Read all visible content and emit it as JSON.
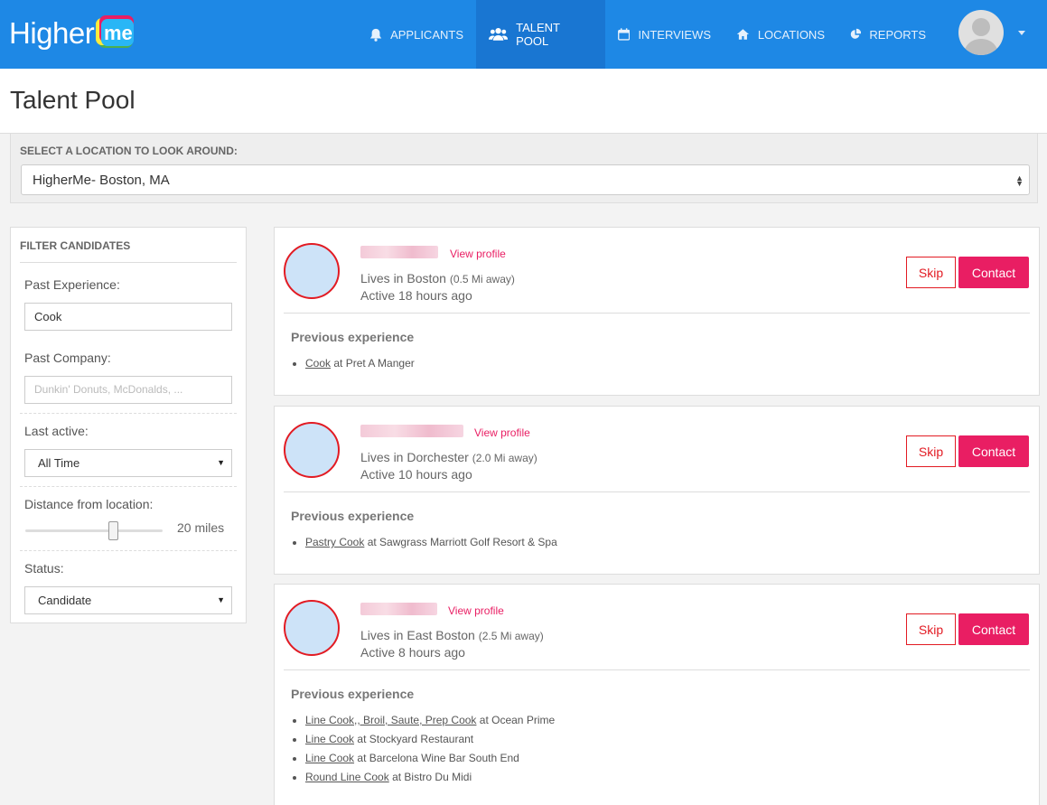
{
  "brand": {
    "name": "Higher",
    "suffix": "me"
  },
  "nav": [
    {
      "label": "Applicants",
      "icon": "bell-icon"
    },
    {
      "label": "Talent Pool",
      "icon": "users-icon",
      "active": true
    },
    {
      "label": "Interviews",
      "icon": "calendar-icon"
    },
    {
      "label": "Locations",
      "icon": "home-icon"
    },
    {
      "label": "Reports",
      "icon": "pie-chart-icon"
    }
  ],
  "page": {
    "title": "Talent Pool"
  },
  "location": {
    "label": "Select a location to look around:",
    "value": "HigherMe- Boston, MA"
  },
  "filters": {
    "heading": "Filter Candidates",
    "past_experience": {
      "label": "Past Experience:",
      "value": "Cook"
    },
    "past_company": {
      "label": "Past Company:",
      "placeholder": "Dunkin' Donuts, McDonalds, ..."
    },
    "last_active": {
      "label": "Last active:",
      "value": "All Time"
    },
    "distance": {
      "label": "Distance from location:",
      "value": "20 miles",
      "fraction": 0.65
    },
    "status": {
      "label": "Status:",
      "value": "Candidate"
    }
  },
  "candidates": [
    {
      "view_label": "View profile",
      "location": "Lives in Boston",
      "distance": "(0.5 Mi away)",
      "active": "Active 18 hours ago",
      "skip_label": "Skip",
      "contact_label": "Contact",
      "prev_heading": "Previous experience",
      "experience": [
        {
          "role": "Cook",
          "company": "at Pret A Manger"
        }
      ]
    },
    {
      "view_label": "View profile",
      "location": "Lives in Dorchester",
      "distance": "(2.0 Mi away)",
      "active": "Active 10 hours ago",
      "skip_label": "Skip",
      "contact_label": "Contact",
      "prev_heading": "Previous experience",
      "experience": [
        {
          "role": "Pastry Cook",
          "company": "at Sawgrass Marriott Golf Resort & Spa"
        }
      ]
    },
    {
      "view_label": "View profile",
      "location": "Lives in East Boston",
      "distance": "(2.5 Mi away)",
      "active": "Active 8 hours ago",
      "skip_label": "Skip",
      "contact_label": "Contact",
      "prev_heading": "Previous experience",
      "experience": [
        {
          "role": "Line Cook,, Broil, Saute, Prep Cook",
          "company": "at Ocean Prime"
        },
        {
          "role": "Line Cook",
          "company": "at Stockyard Restaurant"
        },
        {
          "role": "Line Cook",
          "company": "at Barcelona Wine Bar South End"
        },
        {
          "role": "Round Line Cook",
          "company": "at Bistro Du Midi"
        }
      ]
    }
  ]
}
